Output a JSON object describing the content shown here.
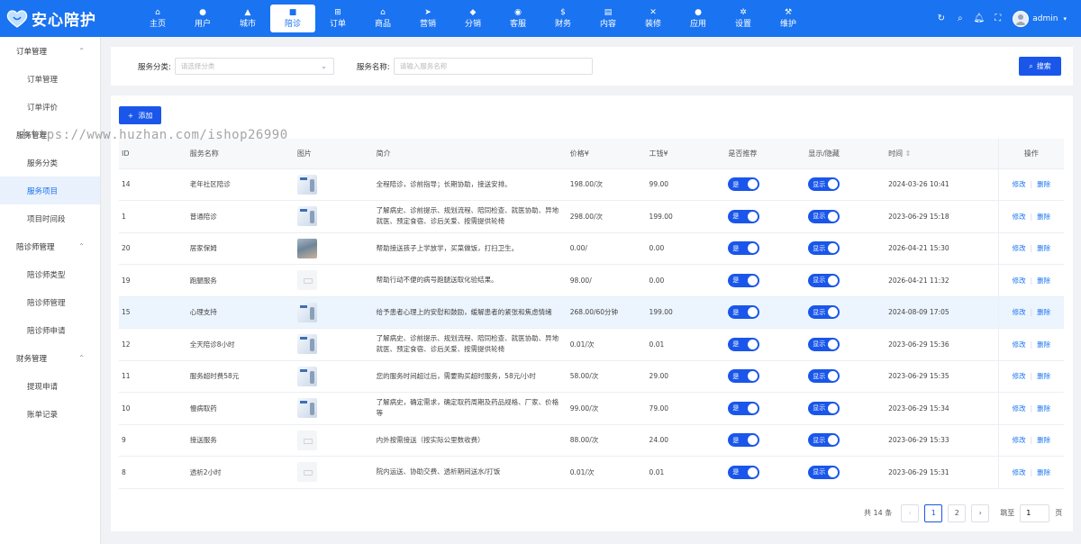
{
  "header": {
    "brand": "安心陪护",
    "nav": [
      {
        "label": "主页",
        "icon": "home-icon",
        "glyph": "⌂"
      },
      {
        "label": "用户",
        "icon": "user-icon",
        "glyph": "●"
      },
      {
        "label": "城市",
        "icon": "city-icon",
        "glyph": "▲"
      },
      {
        "label": "陪诊",
        "icon": "briefcase-icon",
        "glyph": "■",
        "active": true
      },
      {
        "label": "订单",
        "icon": "cart-icon",
        "glyph": "⊞"
      },
      {
        "label": "商品",
        "icon": "shop-icon",
        "glyph": "⌂"
      },
      {
        "label": "营销",
        "icon": "send-icon",
        "glyph": "➤"
      },
      {
        "label": "分销",
        "icon": "share-icon",
        "glyph": "◆"
      },
      {
        "label": "客服",
        "icon": "headset-icon",
        "glyph": "◉"
      },
      {
        "label": "财务",
        "icon": "dollar-icon",
        "glyph": "$"
      },
      {
        "label": "内容",
        "icon": "book-icon",
        "glyph": "▤"
      },
      {
        "label": "装修",
        "icon": "tools-icon",
        "glyph": "✕"
      },
      {
        "label": "应用",
        "icon": "app-icon",
        "glyph": "●"
      },
      {
        "label": "设置",
        "icon": "gear-icon",
        "glyph": "✲"
      },
      {
        "label": "维护",
        "icon": "hammer-icon",
        "glyph": "⚒"
      }
    ],
    "user": "admin"
  },
  "sidebar": [
    {
      "type": "group",
      "label": "订单管理",
      "chevron": "⌃"
    },
    {
      "type": "item",
      "label": "订单管理"
    },
    {
      "type": "item",
      "label": "订单评价"
    },
    {
      "type": "group",
      "label": "服务管理",
      "chevron": ""
    },
    {
      "type": "item",
      "label": "服务分类"
    },
    {
      "type": "item",
      "label": "服务项目",
      "active": true
    },
    {
      "type": "item",
      "label": "项目时间段"
    },
    {
      "type": "group",
      "label": "陪诊师管理",
      "chevron": "⌃"
    },
    {
      "type": "item",
      "label": "陪诊师类型"
    },
    {
      "type": "item",
      "label": "陪诊师管理"
    },
    {
      "type": "item",
      "label": "陪诊师申请"
    },
    {
      "type": "group",
      "label": "财务管理",
      "chevron": "⌃"
    },
    {
      "type": "item",
      "label": "提现申请"
    },
    {
      "type": "item",
      "label": "账单记录"
    }
  ],
  "filters": {
    "category_label": "服务分类:",
    "category_placeholder": "请选择分类",
    "name_label": "服务名称:",
    "name_placeholder": "请输入服务名称",
    "search_button": "搜索"
  },
  "toolbar": {
    "add_button": "添加"
  },
  "table": {
    "columns": [
      "ID",
      "服务名称",
      "图片",
      "简介",
      "价格¥",
      "工钱¥",
      "是否推荐",
      "显示/隐藏",
      "时间",
      "操作"
    ],
    "rows": [
      {
        "id": "14",
        "name": "老年社区陪诊",
        "img": "sample",
        "desc": "全程陪诊，诊前指导；长期协助，接送安排。",
        "price": "198.00/次",
        "wage": "99.00",
        "rec": "是",
        "show": "显示",
        "time": "2024-03-26 10:41"
      },
      {
        "id": "1",
        "name": "普通陪诊",
        "img": "sample",
        "desc": "了解病史、诊前提示、规划流程、陪同检查、就医协助、异地就医、预定食宿、诊后关爱、按需提供轮椅",
        "price": "298.00/次",
        "wage": "199.00",
        "rec": "是",
        "show": "显示",
        "time": "2023-06-29 15:18"
      },
      {
        "id": "20",
        "name": "居家保姆",
        "img": "photo",
        "desc": "帮助接送孩子上学放学，买菜做饭，打扫卫生。",
        "price": "0.00/",
        "wage": "0.00",
        "rec": "是",
        "show": "显示",
        "time": "2026-04-21 15:30"
      },
      {
        "id": "19",
        "name": "跑腿服务",
        "img": "empty",
        "desc": "帮助行动不便的病号跑腿送取化验结果。",
        "price": "98.00/",
        "wage": "0.00",
        "rec": "是",
        "show": "显示",
        "time": "2026-04-21 11:32"
      },
      {
        "id": "15",
        "name": "心理支持",
        "img": "sample",
        "desc": "给予患者心理上的安慰和鼓励，缓解患者的紧张和焦虑情绪",
        "price": "268.00/60分钟",
        "wage": "199.00",
        "rec": "是",
        "show": "显示",
        "time": "2024-08-09 17:05",
        "highlight": true
      },
      {
        "id": "12",
        "name": "全天陪诊8小时",
        "img": "sample",
        "desc": "了解病史、诊前提示、规划流程、陪同检查、就医协助、异地就医、预定食宿、诊后关爱、按需提供轮椅",
        "price": "0.01/次",
        "wage": "0.01",
        "rec": "是",
        "show": "显示",
        "time": "2023-06-29 15:36"
      },
      {
        "id": "11",
        "name": "服务超时费58元",
        "img": "sample",
        "desc": "您的服务时间超过后，需要购买超时服务，58元/小时",
        "price": "58.00/次",
        "wage": "29.00",
        "rec": "是",
        "show": "显示",
        "time": "2023-06-29 15:35"
      },
      {
        "id": "10",
        "name": "慢病取药",
        "img": "sample",
        "desc": "了解病史，确定需求，确定取药周期及药品规格、厂家、价格等",
        "price": "99.00/次",
        "wage": "79.00",
        "rec": "是",
        "show": "显示",
        "time": "2023-06-29 15:34"
      },
      {
        "id": "9",
        "name": "接送服务",
        "img": "empty",
        "desc": "内外按需接送（按实际公里数收费）",
        "price": "88.00/次",
        "wage": "24.00",
        "rec": "是",
        "show": "显示",
        "time": "2023-06-29 15:33"
      },
      {
        "id": "8",
        "name": "透析2小时",
        "img": "empty",
        "desc": "院内运送、协助交费、透析期间送水/打饭",
        "price": "0.01/次",
        "wage": "0.01",
        "rec": "是",
        "show": "显示",
        "time": "2023-06-29 15:31"
      }
    ],
    "edit_label": "修改",
    "delete_label": "删除"
  },
  "pagination": {
    "total": "共 14 条",
    "pages": [
      "1",
      "2"
    ],
    "current": "1",
    "jump_label": "跳至",
    "jump_value": "1",
    "page_suffix": "页"
  },
  "watermark": "https://www.huzhan.com/ishop26990",
  "colors": {
    "primary": "#1a73f0",
    "button": "#1a56ea",
    "highlight_row": "#ecf4fd"
  }
}
